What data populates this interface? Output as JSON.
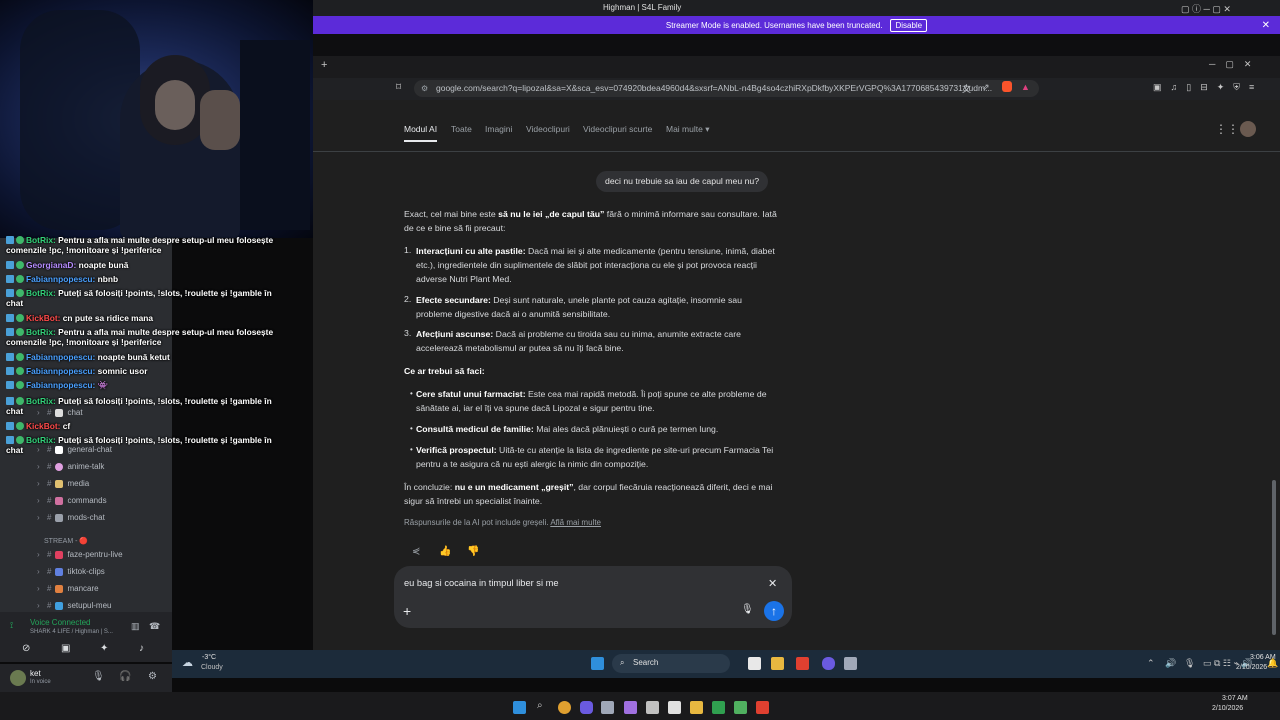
{
  "window": {
    "title": "Highman | S4L Family"
  },
  "banner": {
    "text": "Streamer Mode is enabled. Usernames have been truncated.",
    "button": "Disable"
  },
  "address": {
    "url": "google.com/search?q=lipozal&sa=X&sca_esv=074920bdea4960d4&sxsrf=ANbL-n4Bg4so4czhiRXpDkfbyXKPErVGPQ%3A1770685439731&udm..."
  },
  "gnav": [
    {
      "label": "Modul AI"
    },
    {
      "label": "Toate"
    },
    {
      "label": "Imagini"
    },
    {
      "label": "Videoclipuri"
    },
    {
      "label": "Videoclipuri scurte"
    },
    {
      "label": "Mai multe"
    }
  ],
  "conversation": {
    "user_question": "deci nu trebuie sa iau de capul meu nu?",
    "intro_pre": "Exact, cel mai bine este ",
    "intro_bold": "să nu le iei „de capul tău”",
    "intro_post": " fără o minimă informare sau consultare. Iată de ce e bine să fii precaut:",
    "numbered": [
      {
        "num": "1.",
        "title": "Interacțiuni cu alte pastile:",
        "text": " Dacă mai iei și alte medicamente (pentru tensiune, inimă, diabet etc.), ingredientele din suplimentele de slăbit pot interacționa cu ele și pot provoca reacții adverse Nutri Plant Med."
      },
      {
        "num": "2.",
        "title": "Efecte secundare:",
        "text": " Deși sunt naturale, unele plante pot cauza agitație, insomnie sau probleme digestive dacă ai o anumită sensibilitate."
      },
      {
        "num": "3.",
        "title": "Afecțiuni ascunse:",
        "text": " Dacă ai probleme cu tiroida sau cu inima, anumite extracte care accelerează metabolismul ar putea să nu îți facă bine."
      }
    ],
    "what_to_do": "Ce ar trebui să faci:",
    "bullets": [
      {
        "title": "Cere sfatul unui farmacist:",
        "text": " Este cea mai rapidă metodă. Îi poți spune ce alte probleme de sănătate ai, iar el îți va spune dacă Lipozal e sigur pentru tine."
      },
      {
        "title": "Consultă medicul de familie:",
        "text": " Mai ales dacă plănuiești o cură pe termen lung."
      },
      {
        "title": "Verifică prospectul:",
        "text": " Uită-te cu atenție la lista de ingrediente pe site-uri precum Farmacia Tei pentru a te asigura că nu ești alergic la nimic din compoziție."
      }
    ],
    "conclusion_pre": "În concluzie: ",
    "conclusion_bold": "nu e un medicament „greșit”",
    "conclusion_post": ", dar corpul fiecăruia reacționează diferit, deci e mai sigur să întrebi un specialist înainte.",
    "disclaimer": "Răspunsurile de la AI pot include greșeli.",
    "learn_more": "Află mai multe"
  },
  "input": {
    "value": "eu bag si cocaina in timpul liber si me"
  },
  "chat": [
    {
      "name": "BotRix:",
      "cls": "n-bot",
      "msg": " Pentru a afla mai multe despre setup-ul meu folosește comenzile !pc, !monitoare și !periferice"
    },
    {
      "name": "GeorgianaD:",
      "cls": "n-geo",
      "msg": " noapte bună"
    },
    {
      "name": "Fabiannpopescu:",
      "cls": "n-fab",
      "msg": " nbnb"
    },
    {
      "name": "BotRix:",
      "cls": "n-bot",
      "msg": " Puteți să folosiți !points, !slots, !roulette și !gamble în chat"
    },
    {
      "name": "KickBot:",
      "cls": "n-kick",
      "msg": " cn pute sa ridice mana"
    },
    {
      "name": "BotRix:",
      "cls": "n-bot",
      "msg": " Pentru a afla mai multe despre setup-ul meu folosește comenzile !pc, !monitoare și !periferice"
    },
    {
      "name": "Fabiannpopescu:",
      "cls": "n-fab",
      "msg": " noapte bună ketut"
    },
    {
      "name": "Fabiannpopescu:",
      "cls": "n-fab",
      "msg": " somnic usor"
    },
    {
      "name": "Fabiannpopescu:",
      "cls": "n-fab",
      "msg": " 👾"
    },
    {
      "name": "BotRix:",
      "cls": "n-bot",
      "msg": " Puteți să folosiți !points, !slots, !roulette și !gamble în chat"
    },
    {
      "name": "KickBot:",
      "cls": "n-kick",
      "msg": " cf"
    },
    {
      "name": "BotRix:",
      "cls": "n-bot",
      "msg": " Puteți să folosiți !points, !slots, !roulette și !gamble în chat"
    }
  ],
  "discord": {
    "channels": [
      "chat",
      "general-chat",
      "anime-talk",
      "media",
      "commands",
      "mods-chat"
    ],
    "category": "STREAM - 🔴",
    "stream_channels": [
      "faze-pentru-live",
      "tiktok-clips",
      "mancare",
      "setupul-meu"
    ],
    "voice_connected": "Voice Connected",
    "voice_server": "SHARK 4 LIFE / Highman | S...",
    "user": "ket",
    "user_status": "In voice"
  },
  "weather": {
    "temp": "-3°C",
    "desc": "Cloudy"
  },
  "taskbar_search": "Search",
  "clock1": {
    "time": "3:06 AM",
    "date": "2/10/2026"
  },
  "clock2": {
    "time": "3:07 AM",
    "date": "2/10/2026"
  }
}
